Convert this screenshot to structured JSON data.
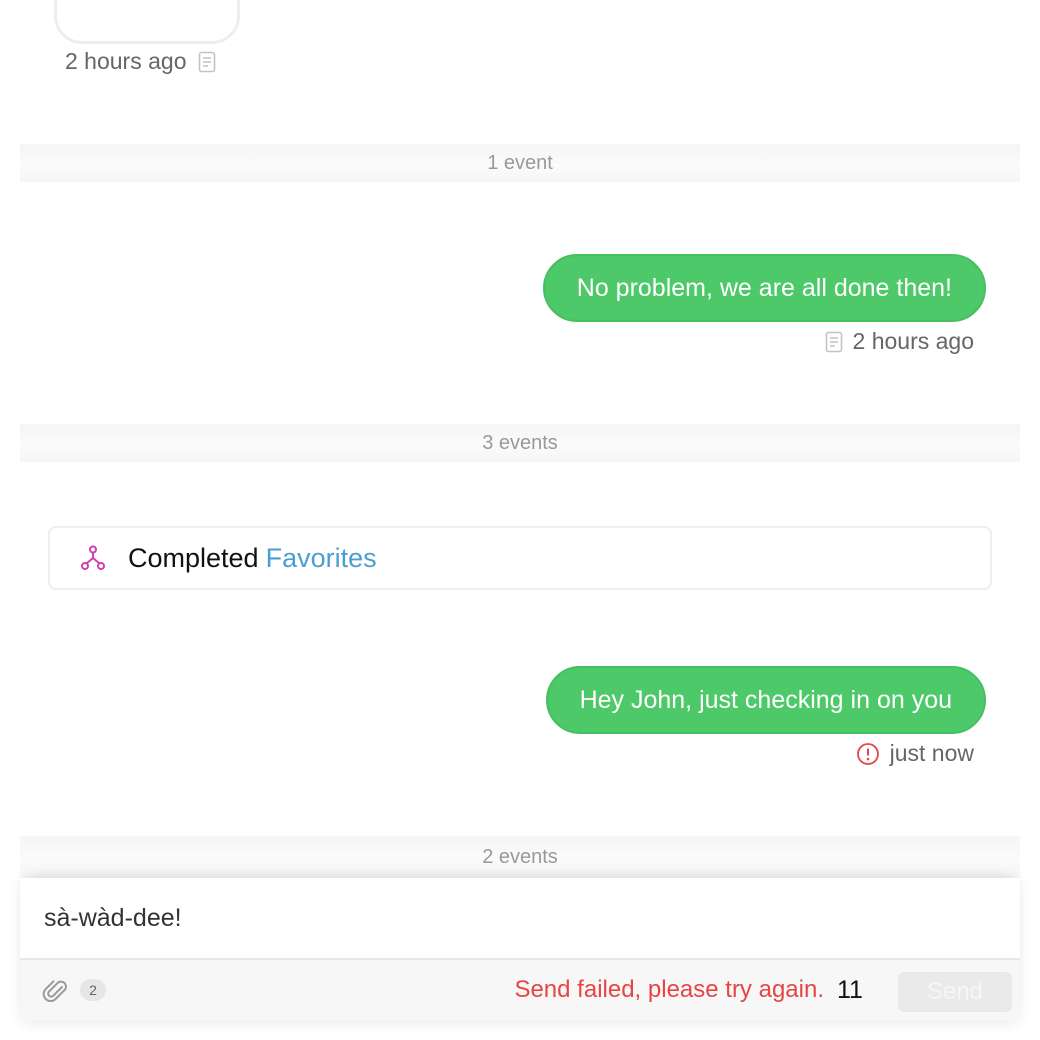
{
  "thread": {
    "previous_message": {
      "timestamp": "2 hours ago",
      "icon": "document-icon"
    },
    "event_bands": [
      {
        "label": "1 event"
      },
      {
        "label": "3 events"
      },
      {
        "label": "2 events"
      }
    ],
    "outgoing_messages": [
      {
        "text": "No problem, we are all done then!",
        "timestamp": "2 hours ago",
        "status_icon": "document-icon"
      },
      {
        "text": "Hey John, just checking in on you",
        "timestamp": "just now",
        "status_icon": "error-icon"
      }
    ],
    "event_card": {
      "icon": "workflow-icon",
      "status_text": "Completed",
      "link_text": "Favorites"
    }
  },
  "composer": {
    "input_value": "sà-wàd-dee!",
    "attachment_count": "2",
    "error_message": "Send failed, please try again.",
    "char_count": "11",
    "send_label": "Send"
  },
  "colors": {
    "bubble_green": "#4ec969",
    "link_blue": "#4b9fd0",
    "error_red": "#e54545",
    "workflow_pink": "#d23fb0"
  }
}
